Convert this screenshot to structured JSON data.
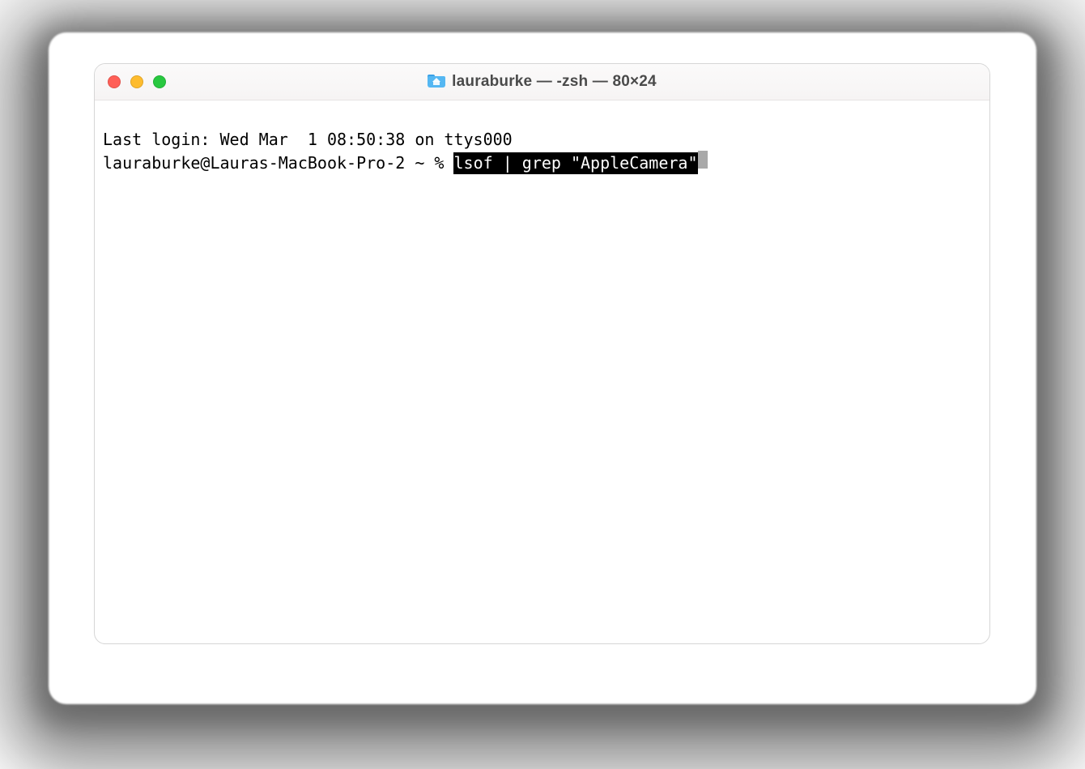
{
  "window": {
    "title": "lauraburke — -zsh — 80×24"
  },
  "terminal": {
    "last_login": "Last login: Wed Mar  1 08:50:38 on ttys000",
    "prompt": "lauraburke@Lauras-MacBook-Pro-2 ~ % ",
    "command_selected": "lsof | grep \"AppleCamera\""
  }
}
